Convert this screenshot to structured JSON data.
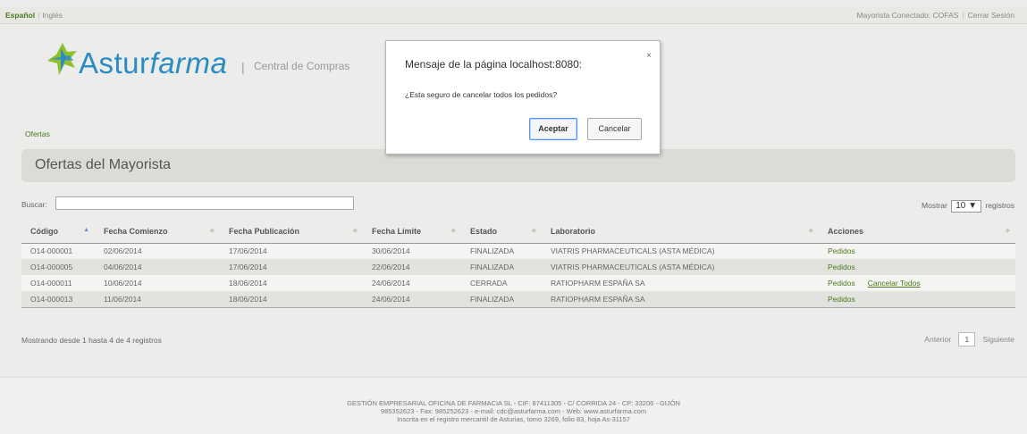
{
  "topbar": {
    "lang_active": "Español",
    "lang_other": "Inglés",
    "user_label": "Mayorista Conectado:",
    "user_name": "COFAS",
    "logout": "Cerrar Sesión"
  },
  "logo": {
    "name_a": "Astur",
    "name_b": "farma",
    "separator": "|",
    "tagline": "Central de Compras"
  },
  "breadcrumb": "Ofertas",
  "page_title": "Ofertas del Mayorista",
  "search": {
    "label": "Buscar:",
    "value": ""
  },
  "page_length": {
    "prefix": "Mostrar",
    "value": "10",
    "suffix": "registros"
  },
  "table": {
    "columns": [
      "Código",
      "Fecha Comienzo",
      "Fecha Publicación",
      "Fecha Límite",
      "Estado",
      "Laboratorio",
      "Acciones"
    ],
    "rows": [
      {
        "codigo": "O14-000001",
        "comienzo": "02/06/2014",
        "publicacion": "17/06/2014",
        "limite": "30/06/2014",
        "estado": "FINALIZADA",
        "laboratorio": "VIATRIS PHARMACEUTICALS (ASTA MÉDICA)",
        "accion": "Pedidos",
        "extra": ""
      },
      {
        "codigo": "O14-000005",
        "comienzo": "04/06/2014",
        "publicacion": "17/06/2014",
        "limite": "22/06/2014",
        "estado": "FINALIZADA",
        "laboratorio": "VIATRIS PHARMACEUTICALS (ASTA MÉDICA)",
        "accion": "Pedidos",
        "extra": ""
      },
      {
        "codigo": "O14-000011",
        "comienzo": "10/06/2014",
        "publicacion": "18/06/2014",
        "limite": "24/06/2014",
        "estado": "CERRADA",
        "laboratorio": "RATIOPHARM ESPAÑA SA",
        "accion": "Pedidos",
        "extra": "Cancelar Todos"
      },
      {
        "codigo": "O14-000013",
        "comienzo": "11/06/2014",
        "publicacion": "18/06/2014",
        "limite": "24/06/2014",
        "estado": "FINALIZADA",
        "laboratorio": "RATIOPHARM ESPAÑA SA",
        "accion": "Pedidos",
        "extra": ""
      }
    ]
  },
  "info": "Mostrando desde 1 hasta 4 de 4 registros",
  "pager": {
    "prev": "Anterior",
    "page": "1",
    "next": "Siguiente"
  },
  "footer": {
    "line1": "GESTIÓN EMPRESARIAL OFICINA DE FARMACIA SL - CIF: 87411305 - C/ CORRIDA 24 - CP: 33206 - GIJÓN",
    "line2": "985352623 - Fax: 985252623 - e-mail: cdc@asturfarma.com - Web: www.asturfarma.com",
    "line3": "Inscrita en el registro mercantil de Asturias, tomo 3269, folio 83, hoja As-31157"
  },
  "dialog": {
    "title": "Mensaje de la página localhost:8080:",
    "close": "×",
    "message": "¿Esta seguro de cancelar todos los pedidos?",
    "ok": "Aceptar",
    "cancel": "Cancelar"
  },
  "colors": {
    "brand_blue": "#2b8cc4",
    "link_green": "#4a7a1e",
    "background": "#ececea"
  }
}
